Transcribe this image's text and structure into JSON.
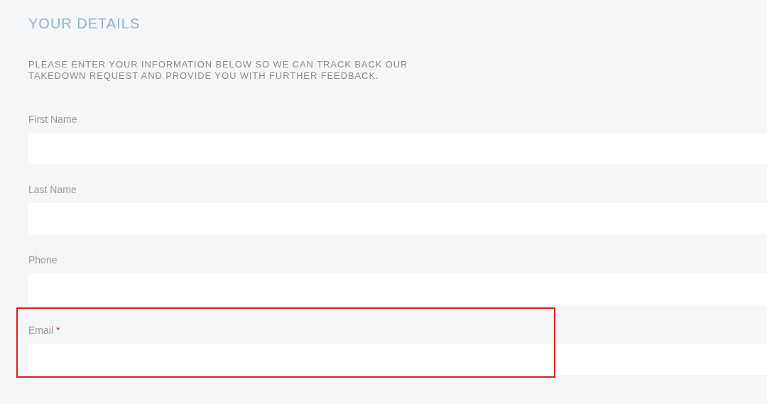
{
  "heading": "YOUR DETAILS",
  "description": "PLEASE ENTER YOUR INFORMATION BELOW SO WE CAN TRACK BACK OUR TAKEDOWN REQUEST AND PROVIDE YOU WITH FURTHER FEEDBACK.",
  "fields": [
    {
      "label": "First Name",
      "highlighted": false
    },
    {
      "label": "Last Name",
      "highlighted": false
    },
    {
      "label": "Phone",
      "highlighted": false
    },
    {
      "label": "Email",
      "required_mark": "*",
      "highlighted": true
    }
  ]
}
